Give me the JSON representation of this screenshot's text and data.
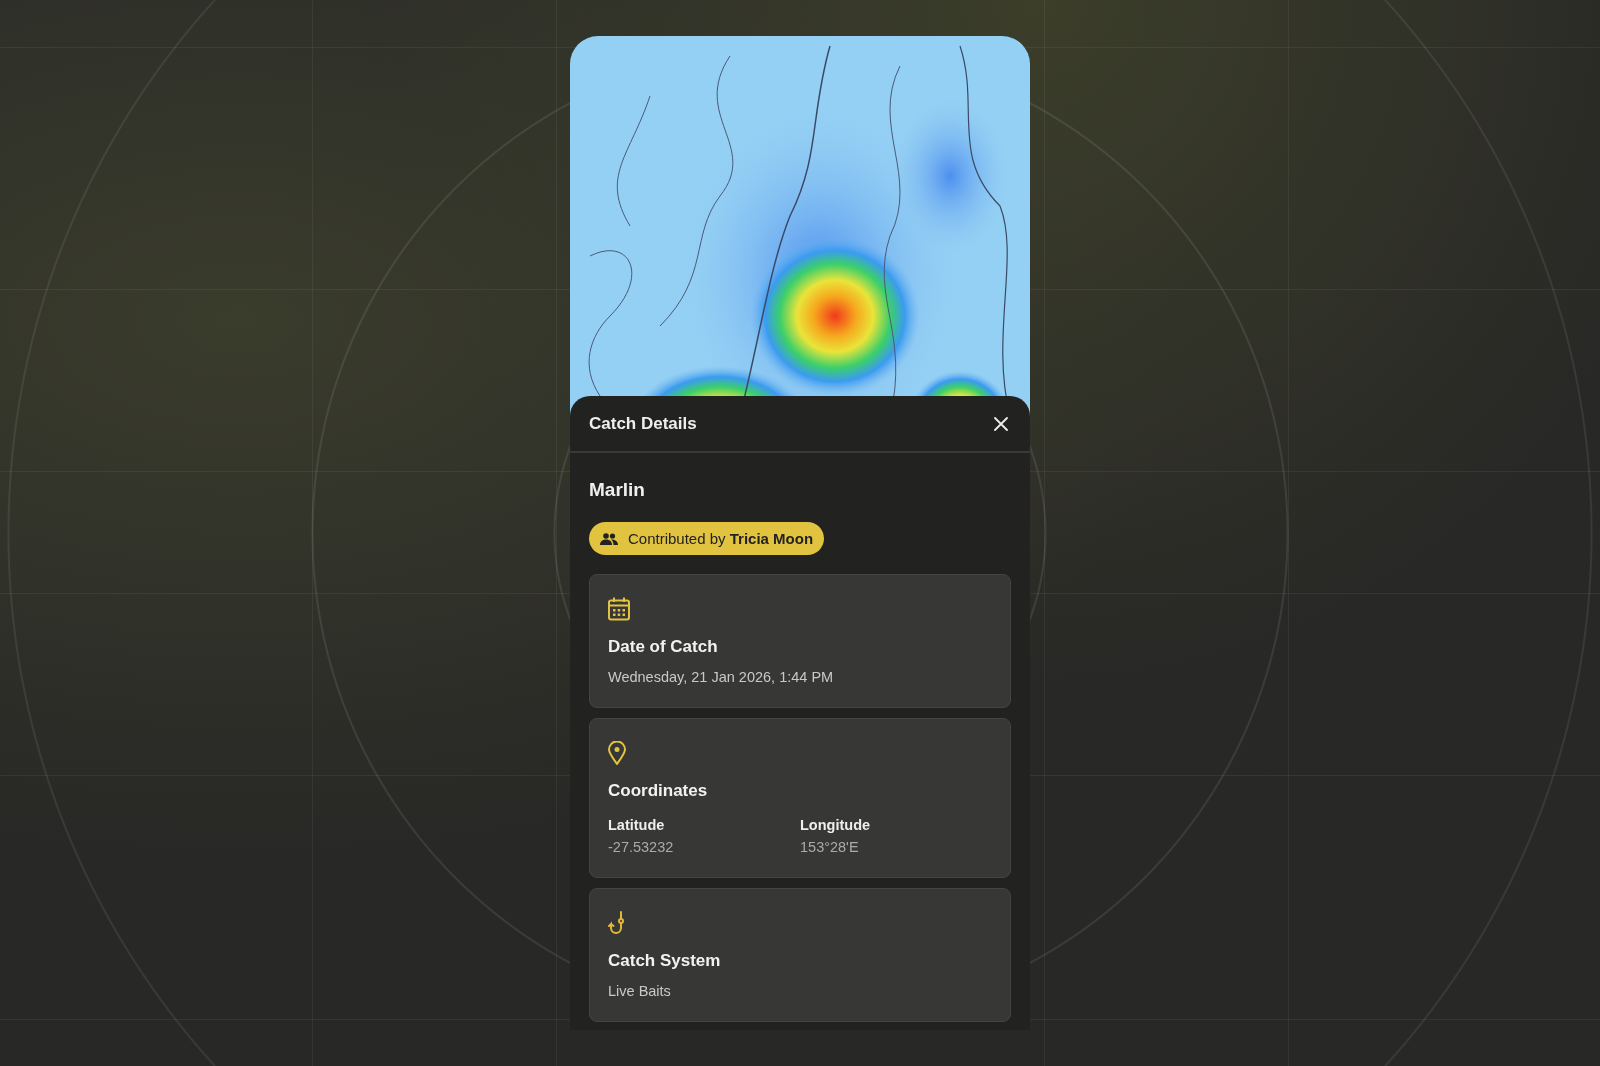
{
  "sheet": {
    "title": "Catch Details",
    "species": "Marlin",
    "contributor": "Contributed by **Tricia Moon**"
  },
  "cards": [
    {
      "kind": "date",
      "title": "Date of Catch",
      "value": "Wednesday, 21 Jan 2026, 1:44 PM"
    },
    {
      "kind": "coordinates",
      "title": "Coordinates",
      "fields": [
        {
          "label": "Latitude",
          "value": "-27.53232"
        },
        {
          "label": "Longitude",
          "value": "153°28'E"
        }
      ]
    },
    {
      "kind": "system",
      "title": "Catch System",
      "value": "Live Baits"
    }
  ]
}
